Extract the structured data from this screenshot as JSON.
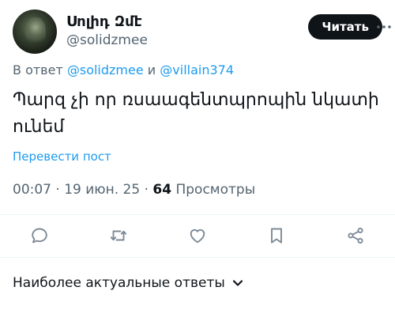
{
  "author": {
    "display_name": "Սոլիդ Զմէ",
    "handle": "@solidzmee"
  },
  "header": {
    "subscribe_label": "Читать"
  },
  "reply": {
    "prefix": "В ответ",
    "mention_1": "@solidzmee",
    "conjunction": "и",
    "mention_2": "@villain374"
  },
  "tweet": {
    "text": "Պարզ չի որ ռսաագենտպրոպին նկատի ունեմ",
    "translate_label": "Перевести пост"
  },
  "meta": {
    "time": "00:07",
    "date": "19 июн. 25",
    "views_count": "64",
    "views_label": "Просмотры"
  },
  "actions": [
    "reply-icon",
    "repost-icon",
    "like-icon",
    "bookmark-icon",
    "share-icon"
  ],
  "sort": {
    "label": "Наиболее актуальные ответы"
  },
  "colors": {
    "accent": "#1d9bf0",
    "text": "#0f1419",
    "secondary": "#536471",
    "icon": "#7d8a96",
    "divider": "#eff3f4"
  }
}
